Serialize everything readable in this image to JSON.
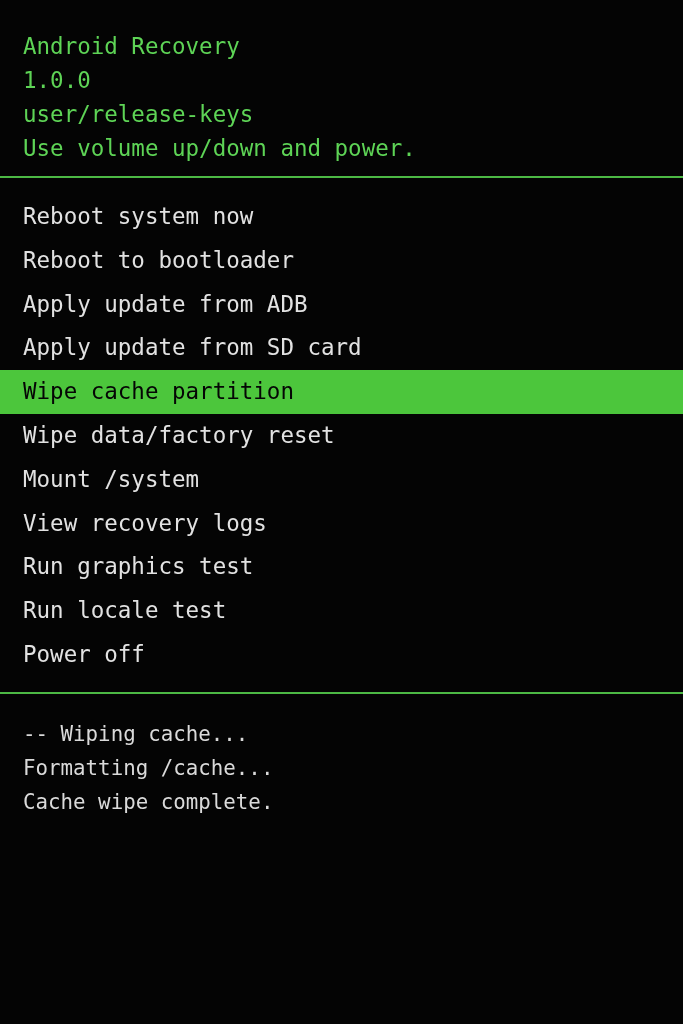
{
  "header": {
    "lines": [
      "Android Recovery",
      "1.0.0",
      "user/release-keys",
      "Use volume up/down and power."
    ]
  },
  "menu": {
    "items": [
      {
        "label": "Reboot system now",
        "selected": false
      },
      {
        "label": "Reboot to bootloader",
        "selected": false
      },
      {
        "label": "Apply update from ADB",
        "selected": false
      },
      {
        "label": "Apply update from SD card",
        "selected": false
      },
      {
        "label": "Wipe cache partition",
        "selected": true
      },
      {
        "label": "Wipe data/factory reset",
        "selected": false
      },
      {
        "label": "Mount /system",
        "selected": false
      },
      {
        "label": "View recovery logs",
        "selected": false
      },
      {
        "label": "Run graphics test",
        "selected": false
      },
      {
        "label": "Run locale test",
        "selected": false
      },
      {
        "label": "Power off",
        "selected": false
      }
    ]
  },
  "log": {
    "lines": [
      "-- Wiping cache...",
      "Formatting /cache...",
      "Cache wipe complete."
    ]
  }
}
